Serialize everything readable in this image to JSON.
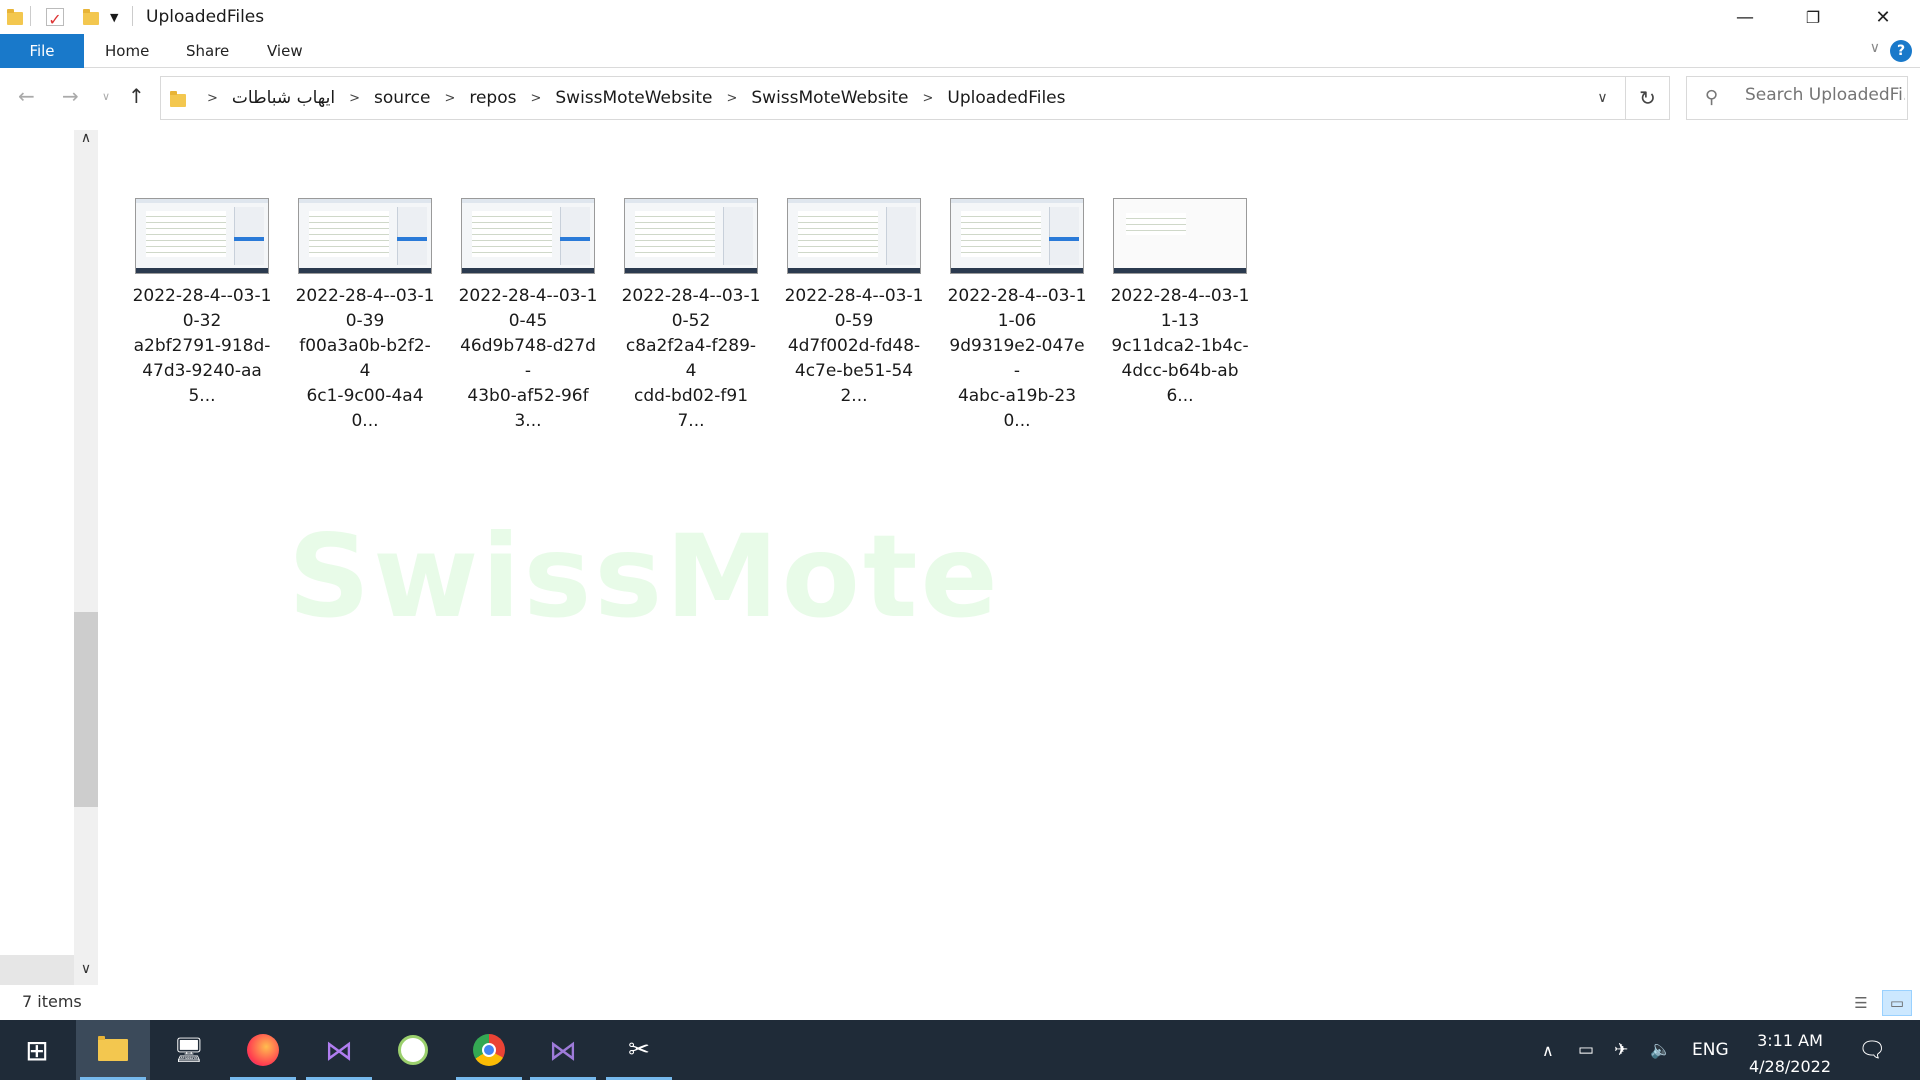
{
  "window": {
    "title": "UploadedFiles",
    "controls": {
      "minimize": "—",
      "restore": "❐",
      "close": "✕"
    }
  },
  "ribbon": {
    "tabs": [
      "File",
      "Home",
      "Share",
      "View"
    ],
    "help": "?"
  },
  "address": {
    "crumbs": [
      "ايهاب شباطات",
      "source",
      "repos",
      "SwissMoteWebsite",
      "SwissMoteWebsite",
      "UploadedFiles"
    ]
  },
  "search": {
    "placeholder": "Search UploadedFi..."
  },
  "files": [
    {
      "line1": "2022-28-4--03-1",
      "line2": "0-32",
      "line3": "a2bf2791-918d-",
      "line4": "47d3-9240-aa5..."
    },
    {
      "line1": "2022-28-4--03-1",
      "line2": "0-39",
      "line3": "f00a3a0b-b2f2-4",
      "line4": "6c1-9c00-4a40..."
    },
    {
      "line1": "2022-28-4--03-1",
      "line2": "0-45",
      "line3": "46d9b748-d27d-",
      "line4": "43b0-af52-96f3..."
    },
    {
      "line1": "2022-28-4--03-1",
      "line2": "0-52",
      "line3": "c8a2f2a4-f289-4",
      "line4": "cdd-bd02-f917..."
    },
    {
      "line1": "2022-28-4--03-1",
      "line2": "0-59",
      "line3": "4d7f002d-fd48-",
      "line4": "4c7e-be51-542..."
    },
    {
      "line1": "2022-28-4--03-1",
      "line2": "1-06",
      "line3": "9d9319e2-047e-",
      "line4": "4abc-a19b-230..."
    },
    {
      "line1": "2022-28-4--03-1",
      "line2": "1-13",
      "line3": "9c11dca2-1b4c-",
      "line4": "4dcc-b64b-ab6..."
    }
  ],
  "watermark": "SwissMote",
  "status": {
    "item_count": "7 items"
  },
  "tray": {
    "language": "ENG",
    "time": "3:11 AM",
    "date": "4/28/2022"
  },
  "colors": {
    "accent": "#1979ca",
    "taskbar": "#1f2b38",
    "watermark": "#e8fbe8"
  }
}
